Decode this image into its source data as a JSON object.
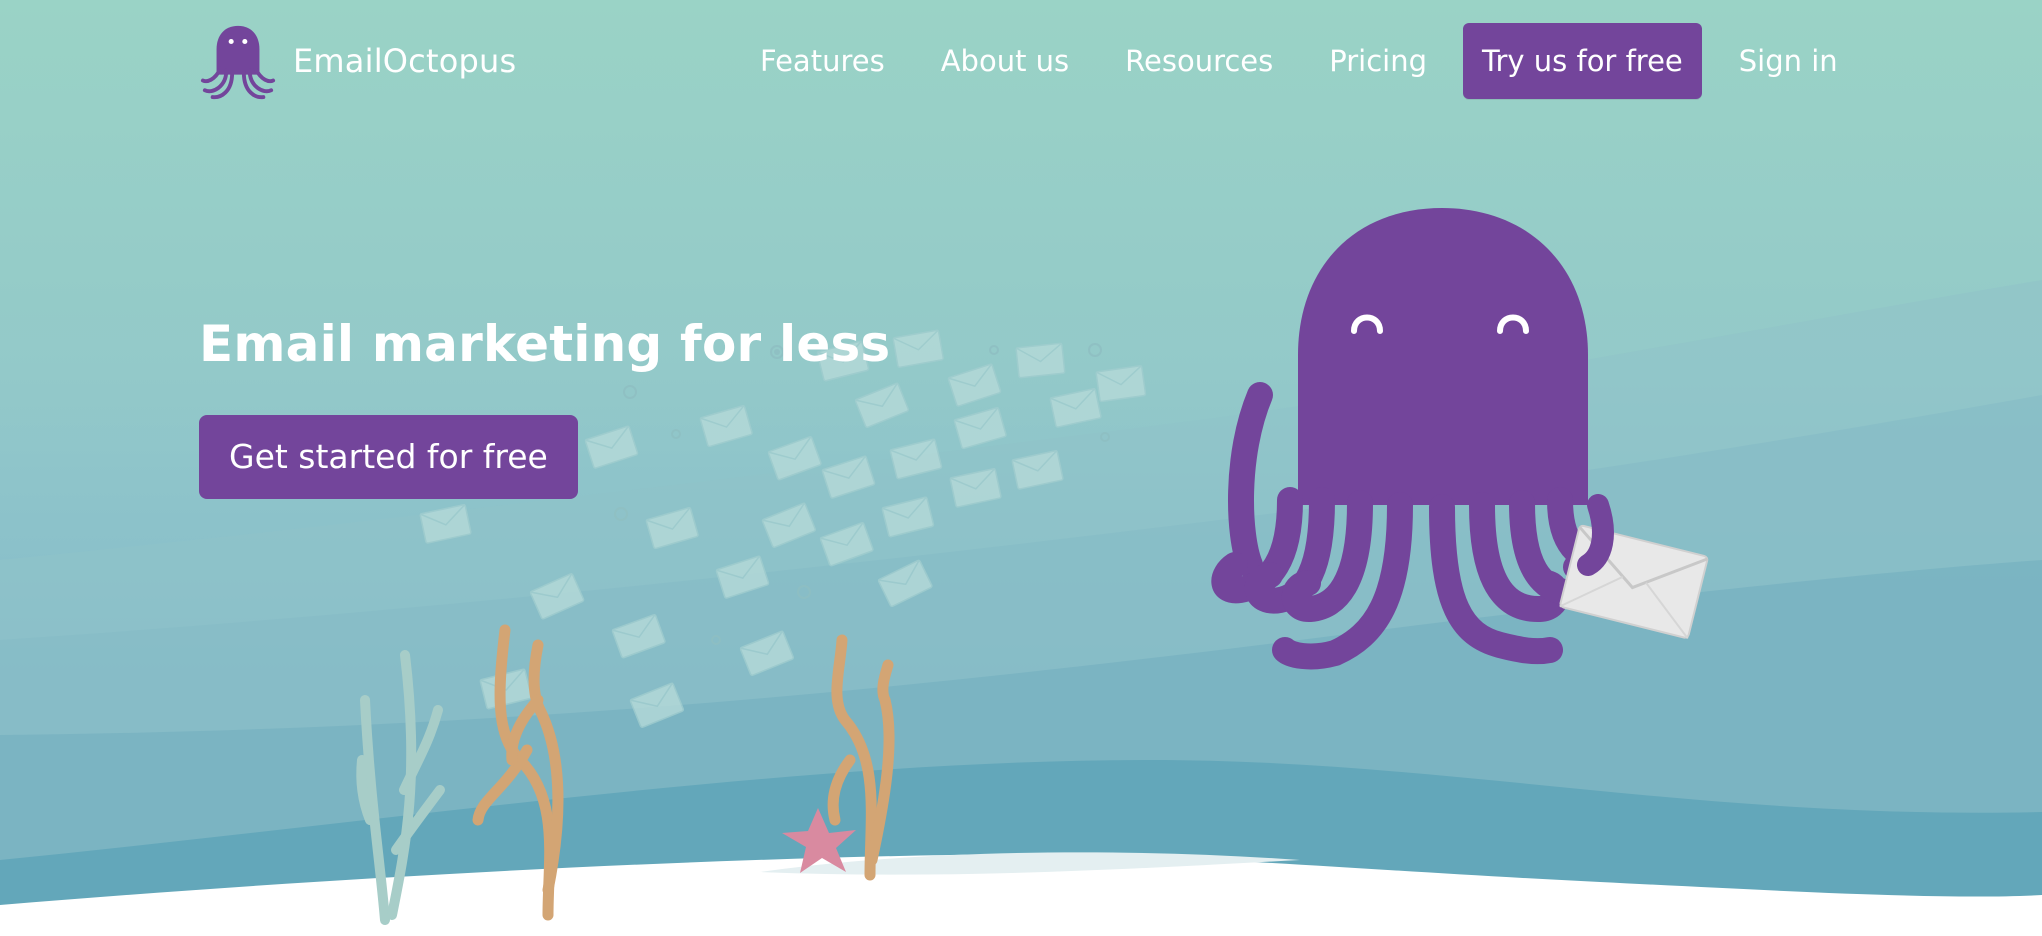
{
  "brand": {
    "name": "EmailOctopus",
    "logo_icon": "octopus-logo-icon"
  },
  "nav": {
    "items": [
      {
        "label": "Features"
      },
      {
        "label": "About us"
      },
      {
        "label": "Resources"
      },
      {
        "label": "Pricing"
      }
    ],
    "cta_label": "Try us for free",
    "signin_label": "Sign in"
  },
  "hero": {
    "title": "Email marketing for less",
    "cta_label": "Get started for free",
    "illustration": "octopus-holding-envelope-icon"
  },
  "colors": {
    "brand_purple": "#73459b",
    "sea_light": "#9ad3c6",
    "sea_deep": "#62a6bb",
    "sand": "#ffffff",
    "coral_orange": "#d3a574",
    "coral_green": "#a7cdc8",
    "starfish": "#d98aa0"
  }
}
